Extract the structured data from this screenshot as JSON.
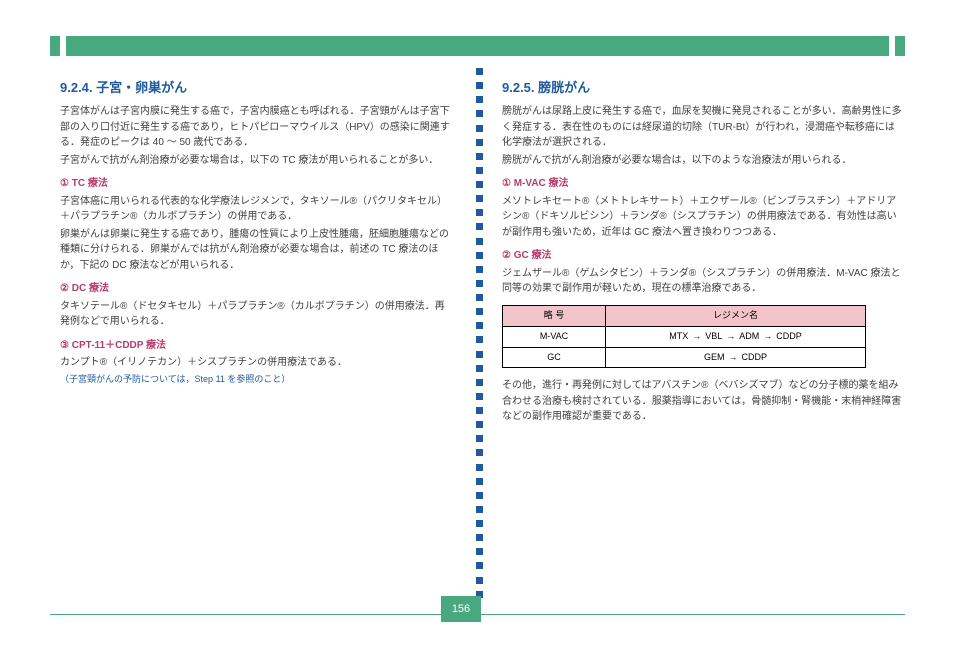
{
  "page_number": "156",
  "left": {
    "section_title": "9.2.4. 子宮・卵巣がん",
    "p1": "子宮体がんは子宮内膜に発生する癌で，子宮内膜癌とも呼ばれる．子宮頸がんは子宮下部の入り口付近に発生する癌であり，ヒトパピローマウイルス（HPV）の感染に関連する．発症のピークは 40 ～ 50 歳代である．",
    "p2": "子宮がんで抗がん剤治療が必要な場合は，以下の TC 療法が用いられることが多い．",
    "regimen1_title": "① TC 療法",
    "regimen1_body": "子宮体癌に用いられる代表的な化学療法レジメンで，タキソール®（パクリタキセル）＋パラプラチン®（カルボプラチン）の併用である．",
    "p3": "卵巣がんは卵巣に発生する癌であり，腫瘍の性質により上皮性腫瘍，胚細胞腫瘍などの種類に分けられる．卵巣がんでは抗がん剤治療が必要な場合は，前述の TC 療法のほか，下記の DC 療法などが用いられる．",
    "regimen2_title": "② DC 療法",
    "regimen2_body": "タキソテール®（ドセタキセル）＋パラプラチン®（カルボプラチン）の併用療法．再発例などで用いられる．",
    "regimen3_title": "③ CPT-11＋CDDP 療法",
    "regimen3_body": "カンプト®（イリノテカン）＋シスプラチンの併用療法である．",
    "crossref": "（子宮頸がんの予防については，Step 11 を参照のこと）"
  },
  "right": {
    "section_title": "9.2.5. 膀胱がん",
    "p1": "膀胱がんは尿路上皮に発生する癌で，血尿を契機に発見されることが多い．高齢男性に多く発症する．表在性のものには経尿道的切除（TUR-Bt）が行われ，浸潤癌や転移癌には化学療法が選択される．",
    "p2": "膀胱がんで抗がん剤治療が必要な場合は，以下のような治療法が用いられる．",
    "regimen1_title": "① M-VAC 療法",
    "regimen1_body": "メソトレキセート®（メトトレキサート）＋エクザール®（ビンブラスチン）＋アドリアシン®（ドキソルビシン）＋ランダ®（シスプラチン）の併用療法である．有効性は高いが副作用も強いため，近年は GC 療法へ置き換わりつつある．",
    "regimen2_title": "② GC 療法",
    "regimen2_body": "ジェムザール®（ゲムシタビン）＋ランダ®（シスプラチン）の併用療法．M-VAC 療法と同等の効果で副作用が軽いため，現在の標準治療である．",
    "table": {
      "header": [
        "略 号",
        "レジメン名"
      ],
      "rows": [
        [
          "M-VAC",
          [
            "MTX",
            "VBL",
            "ADM",
            "CDDP"
          ]
        ],
        [
          "GC",
          [
            "GEM",
            "CDDP"
          ]
        ]
      ]
    },
    "after_table": "その他，進行・再発例に対してはアバスチン®（ベバシズマブ）などの分子標的薬を組み合わせる治療も検討されている．服薬指導においては，骨髄抑制・腎機能・末梢神経障害などの副作用確認が重要である．"
  }
}
